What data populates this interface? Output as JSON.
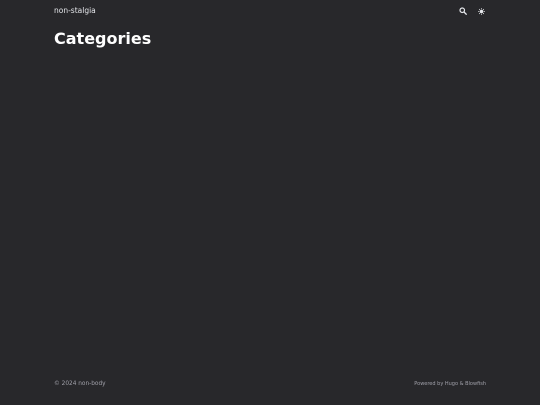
{
  "header": {
    "site_title": "non-stalgia",
    "icons": [
      "search-icon",
      "appearance-toggle-icon"
    ]
  },
  "main": {
    "title": "Categories"
  },
  "footer": {
    "copyright": "© 2024 non-body",
    "powered_by": "Powered by Hugo & Blowfish"
  },
  "colors": {
    "background": "#28282b",
    "text": "#e5e7eb",
    "muted": "#a1a1aa"
  }
}
